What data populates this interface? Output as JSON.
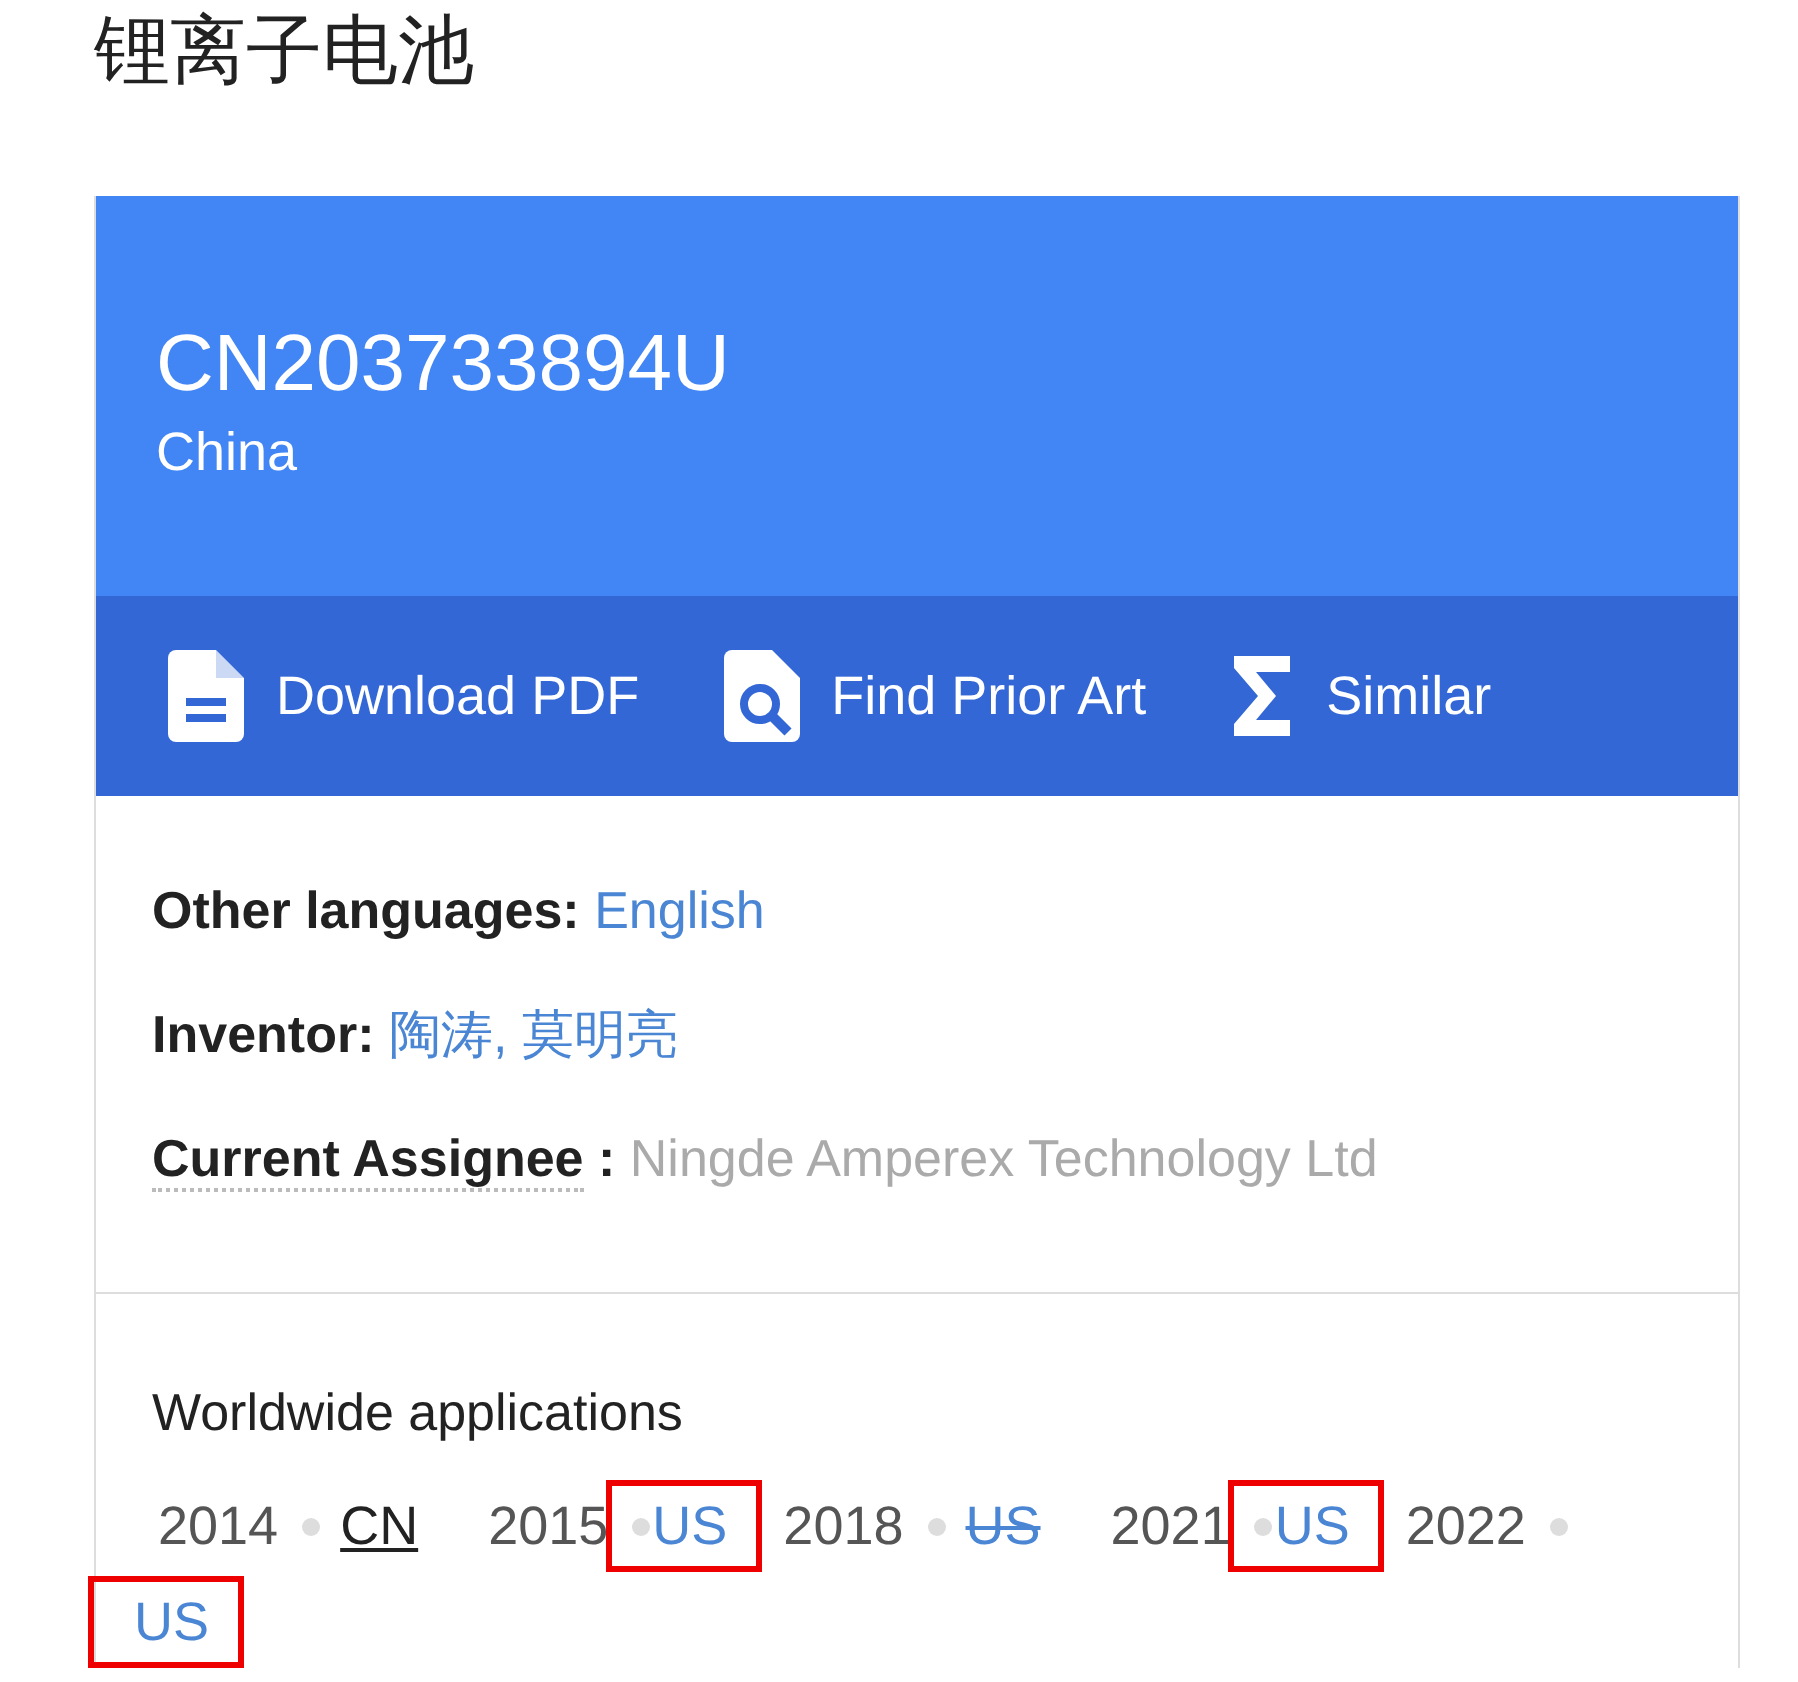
{
  "title": "锂离子电池",
  "patent": {
    "number": "CN203733894U",
    "country": "China"
  },
  "actions": [
    {
      "kind": "document",
      "label": "Download PDF"
    },
    {
      "kind": "search",
      "label": "Find Prior Art"
    },
    {
      "kind": "sigma",
      "label": "Similar"
    }
  ],
  "fields": [
    {
      "label": "Other languages:",
      "links": [
        "English"
      ],
      "muted": false,
      "dotted": false
    },
    {
      "label": "Inventor:",
      "links": [
        "陶涛",
        "莫明亮"
      ],
      "link_separator": ",",
      "muted": false,
      "dotted": false
    },
    {
      "label": "Current Assignee",
      "label_suffix": ":",
      "links": [
        "Ningde Amperex Technology Ltd"
      ],
      "muted": true,
      "dotted": true
    }
  ],
  "worldwide": {
    "heading": "Worldwide applications",
    "applications": [
      {
        "year": "2014",
        "country": "CN",
        "current": true,
        "struck": false,
        "highlighted": false
      },
      {
        "year": "2015",
        "country": "US",
        "current": false,
        "struck": false,
        "highlighted": true
      },
      {
        "year": "2018",
        "country": "US",
        "current": false,
        "struck": true,
        "highlighted": false
      },
      {
        "year": "2021",
        "country": "US",
        "current": false,
        "struck": false,
        "highlighted": true
      },
      {
        "year": "2022",
        "country": "US",
        "current": false,
        "struck": false,
        "highlighted": true
      }
    ]
  }
}
